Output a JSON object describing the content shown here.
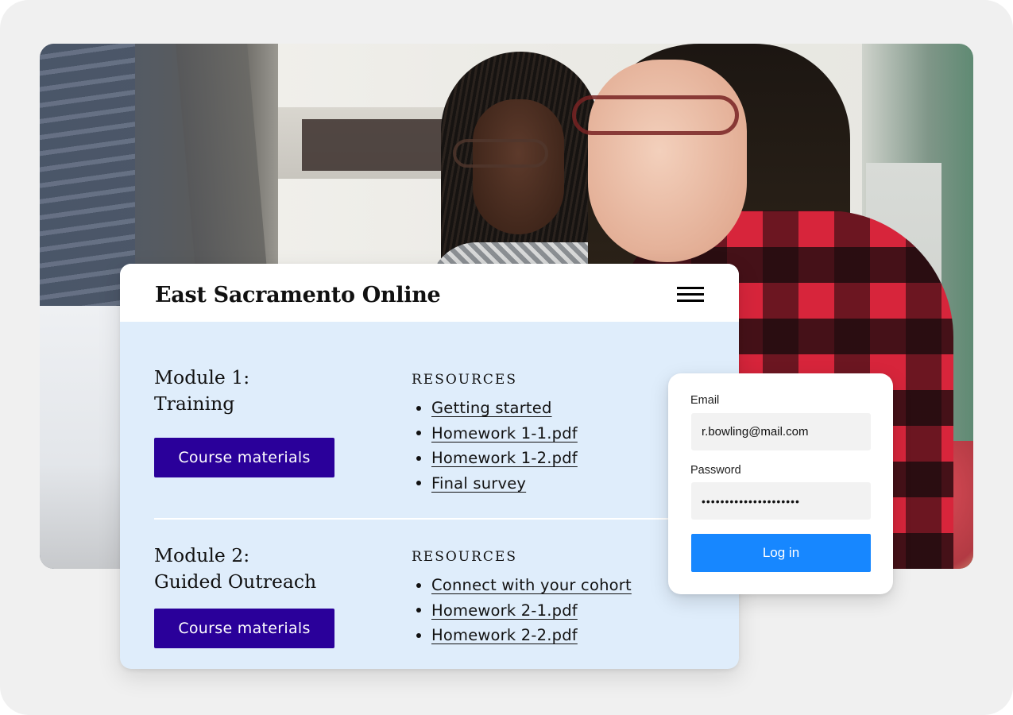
{
  "site": {
    "title": "East Sacramento Online",
    "menu_icon": "hamburger-menu-icon"
  },
  "modules": [
    {
      "title": "Module 1:\nTraining",
      "button_label": "Course materials",
      "resources_heading": "Resources",
      "resources": [
        "Getting started",
        "Homework 1-1.pdf",
        "Homework 1-2.pdf",
        "Final survey"
      ]
    },
    {
      "title": "Module 2:\nGuided Outreach",
      "button_label": "Course materials",
      "resources_heading": "Resources",
      "resources": [
        "Connect with your cohort",
        "Homework 2-1.pdf",
        "Homework 2-2.pdf"
      ]
    }
  ],
  "login": {
    "email_label": "Email",
    "email_value": "r.bowling@mail.com",
    "password_label": "Password",
    "password_value": "•••••••••••••••••••••",
    "submit_label": "Log in"
  },
  "colors": {
    "card_background": "#dfedfb",
    "course_button": "#2a009a",
    "login_button": "#1787ff",
    "page_background": "#f0f0f0"
  }
}
